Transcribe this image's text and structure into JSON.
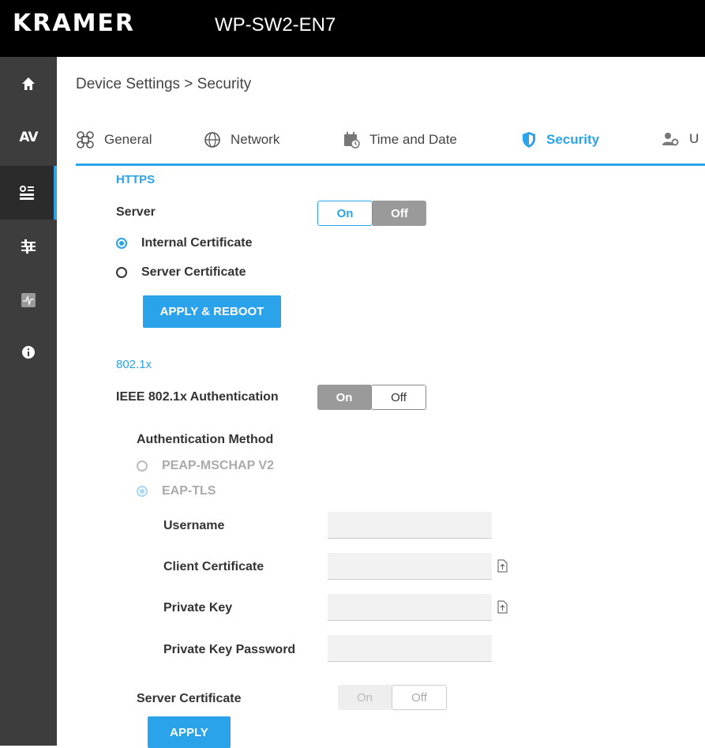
{
  "header": {
    "logo": "KRAMER",
    "model": "WP-SW2-EN7"
  },
  "sidebar": {
    "items": [
      {
        "icon": "home-icon"
      },
      {
        "icon": "av-icon",
        "label": "AV"
      },
      {
        "icon": "device-settings-icon",
        "active": true
      },
      {
        "icon": "sliders-icon"
      },
      {
        "icon": "diagnostics-icon"
      },
      {
        "icon": "info-icon"
      }
    ]
  },
  "breadcrumb": "Device Settings > Security",
  "tabs": [
    {
      "label": "General",
      "icon": "general-icon"
    },
    {
      "label": "Network",
      "icon": "network-icon"
    },
    {
      "label": "Time and Date",
      "icon": "calendar-icon"
    },
    {
      "label": "Security",
      "icon": "shield-icon",
      "active": true
    },
    {
      "label": "U",
      "icon": "users-icon"
    }
  ],
  "https": {
    "title": "HTTPS",
    "server_label": "Server",
    "server_toggle": {
      "on": "On",
      "off": "Off",
      "selected": "On"
    },
    "internal_cert": "Internal Certificate",
    "server_cert": "Server Certificate",
    "selected_cert": "Internal Certificate",
    "apply_reboot": "APPLY & REBOOT"
  },
  "dot1x": {
    "title": "802.1x",
    "auth_label": "IEEE 802.1x Authentication",
    "auth_toggle": {
      "on": "On",
      "off": "Off",
      "selected": "Off"
    },
    "method_label": "Authentication Method",
    "peap": "PEAP-MSCHAP V2",
    "eaptls": "EAP-TLS",
    "selected_method": "EAP-TLS",
    "username_label": "Username",
    "username_value": "",
    "client_cert_label": "Client Certificate",
    "client_cert_value": "",
    "private_key_label": "Private Key",
    "private_key_value": "",
    "private_key_pw_label": "Private Key Password",
    "private_key_pw_value": "",
    "server_cert_label": "Server Certificate",
    "server_cert_toggle": {
      "on": "On",
      "off": "Off",
      "selected": "Off"
    },
    "apply": "APPLY"
  },
  "colors": {
    "accent": "#2aa3ea",
    "sidebar": "#3d3d3d",
    "topbar": "#000000"
  }
}
